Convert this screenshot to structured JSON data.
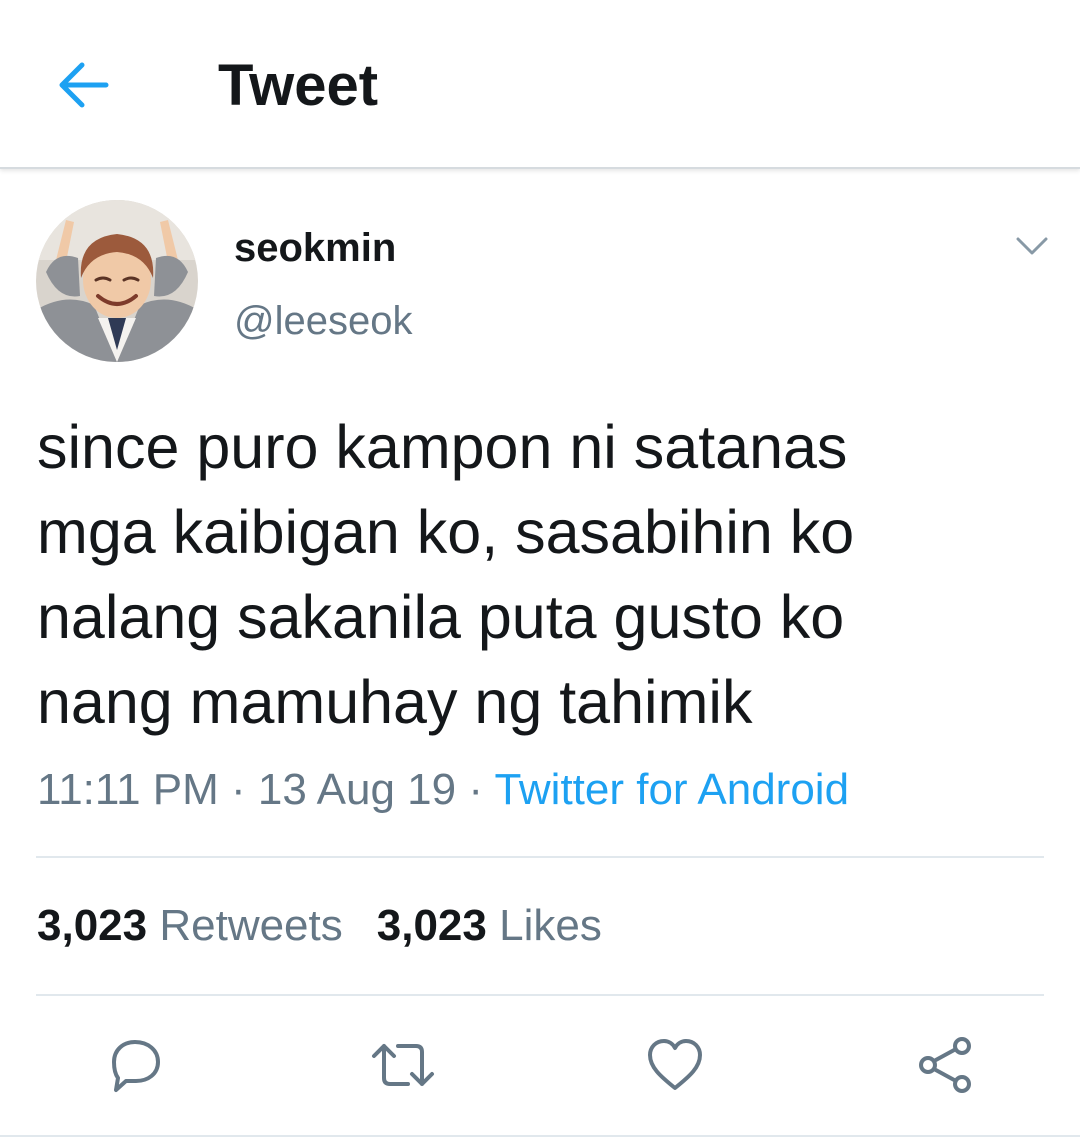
{
  "header": {
    "back_icon": "arrow-left-icon",
    "title": "Tweet",
    "accent_color": "#1da1f2"
  },
  "tweet": {
    "author": {
      "display_name": "seokmin",
      "handle": "@leeseok",
      "avatar": "avatar-photo"
    },
    "menu_icon": "chevron-down-icon",
    "text": "since puro kampon ni satanas\nmga kaibigan ko, sasabihin ko\nnalang sakanila puta gusto ko\nnang mamuhay ng tahimik",
    "time": "11:11 PM",
    "separator": " · ",
    "date": "13 Aug 19",
    "source": "Twitter for Android",
    "stats": {
      "retweets_count": "3,023",
      "retweets_label": "Retweets",
      "likes_count": "3,023",
      "likes_label": "Likes"
    },
    "actions": [
      {
        "name": "reply",
        "icon": "reply-icon"
      },
      {
        "name": "retweet",
        "icon": "retweet-icon"
      },
      {
        "name": "like",
        "icon": "heart-icon"
      },
      {
        "name": "share",
        "icon": "share-icon"
      }
    ]
  },
  "colors": {
    "text": "#14171a",
    "secondary": "#657786",
    "link": "#1da1f2",
    "divider": "#e1e8ed"
  }
}
